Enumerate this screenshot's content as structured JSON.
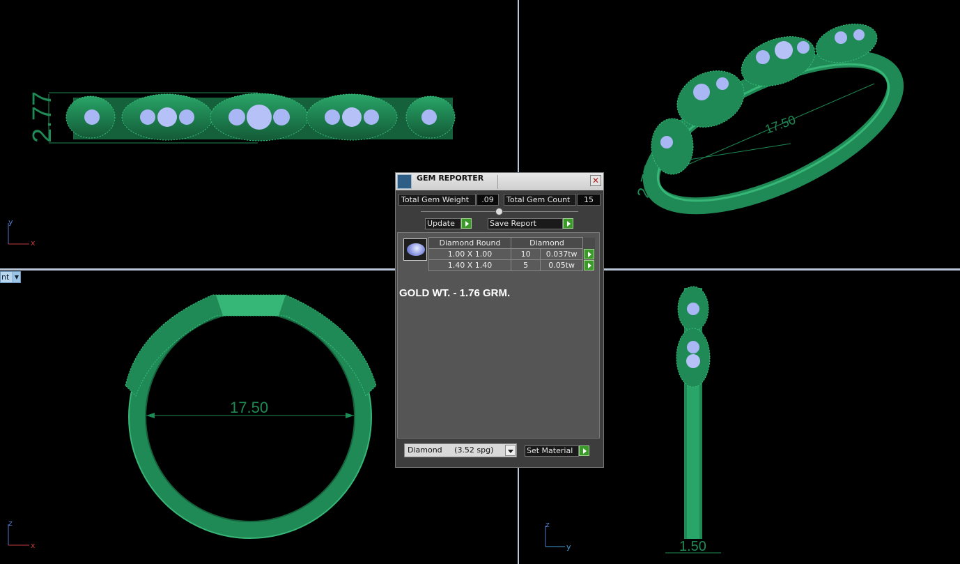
{
  "viewports": {
    "top_left": {
      "axis_v": "y",
      "axis_h": "x",
      "dimension": "2.77"
    },
    "top_right": {
      "dimension_long": "17.50",
      "dimension_short": "2.77"
    },
    "bottom_left": {
      "axis_v": "z",
      "axis_h": "x",
      "dimension": "17.50"
    },
    "bottom_right": {
      "axis_v": "z",
      "axis_h": "y",
      "dimension": "1.50"
    },
    "view_menu_label": "nt"
  },
  "colors": {
    "metal": "#1f8a55",
    "metal_light": "#36b677",
    "gem": "#a9b8f5",
    "background": "#000000"
  },
  "gem_reporter": {
    "title": "GEM REPORTER",
    "total_weight_label": "Total Gem Weight",
    "total_weight_value": ".09",
    "total_count_label": "Total Gem Count",
    "total_count_value": "15",
    "update_label": "Update",
    "save_report_label": "Save Report",
    "table": {
      "headers": [
        "Diamond Round",
        "Diamond"
      ],
      "rows": [
        {
          "size": "1.00 X 1.00",
          "count": "10",
          "weight": "0.037tw"
        },
        {
          "size": "1.40 X 1.40",
          "count": "5",
          "weight": "0.05tw"
        }
      ]
    },
    "gold_note": "GOLD WT. - 1.76 GRM.",
    "material_select": "Diamond     (3.52 spg)",
    "set_material_label": "Set Material",
    "icons": {
      "title": "gem-reporter-icon",
      "close": "close-icon",
      "gem": "round-diamond-icon"
    }
  }
}
